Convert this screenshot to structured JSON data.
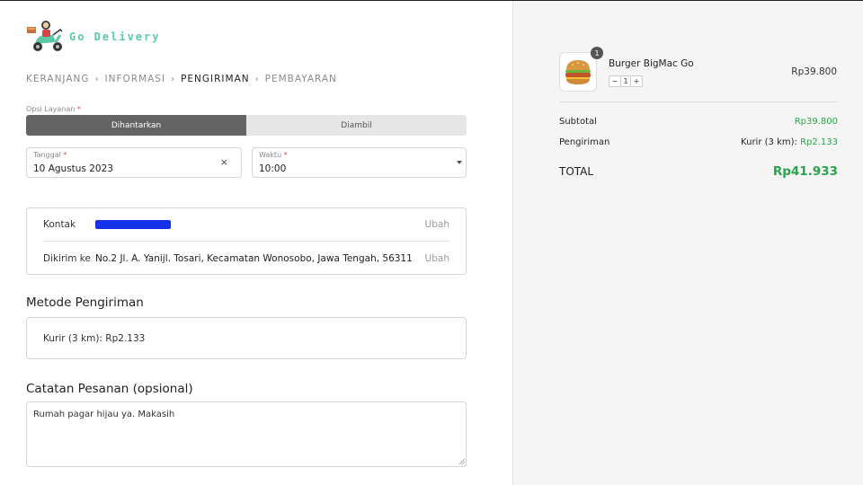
{
  "brand": {
    "name": "Go Delivery",
    "logo_icon": "scooter-delivery-icon",
    "color": "#5dc8a8"
  },
  "breadcrumb": [
    {
      "label": "KERANJANG"
    },
    {
      "label": "INFORMASI"
    },
    {
      "label": "PENGIRIMAN"
    },
    {
      "label": "PEMBAYARAN"
    }
  ],
  "service": {
    "label": "Opsi Layanan",
    "required_mark": "*",
    "options": [
      "Dihantarkan",
      "Diambil"
    ],
    "selected": "Dihantarkan"
  },
  "date_field": {
    "label": "Tanggal",
    "required_mark": "*",
    "value": "10 Agustus 2023",
    "clear_symbol": "×"
  },
  "time_field": {
    "label": "Waktu",
    "required_mark": "*",
    "value": "10:00"
  },
  "contact": {
    "contact_label": "Kontak",
    "contact_action": "Ubah",
    "address_label": "Dikirim ke",
    "address_value": "No.2 Jl. A. Yanijl. Tosari, Kecamatan Wonosobo, Jawa Tengah, 56311",
    "address_action": "Ubah"
  },
  "shipping_method": {
    "title": "Metode Pengiriman",
    "value": "Kurir (3 km): Rp2.133"
  },
  "notes": {
    "title": "Catatan Pesanan (opsional)",
    "value": "Rumah pagar hijau ya. Makasih"
  },
  "cart": {
    "item": {
      "name": "Burger BigMac Go",
      "badge": "1",
      "quantity": "1",
      "price": "Rp39.800",
      "minus": "−",
      "plus": "+"
    },
    "subtotal_label": "Subtotal",
    "subtotal_value": "Rp39.800",
    "shipping_label": "Pengiriman",
    "shipping_prefix": "Kurir (3 km): ",
    "shipping_value": "Rp2.133",
    "total_label": "TOTAL",
    "total_value": "Rp41.933",
    "accent_color": "#2aa34a"
  }
}
